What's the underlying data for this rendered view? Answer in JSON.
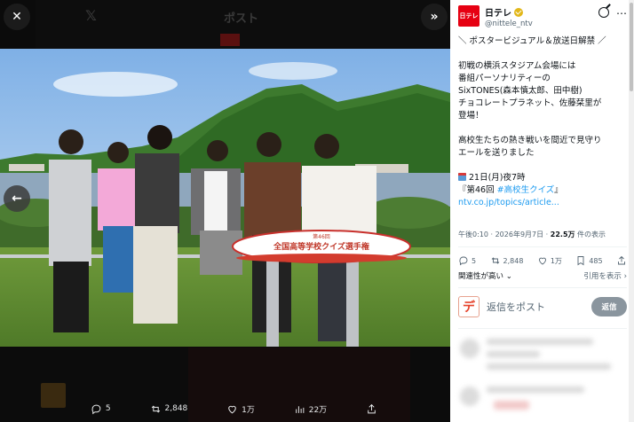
{
  "viewer": {
    "ghost_post_label": "ポスト",
    "ghost_logo_text": "日テレ",
    "sign_line1": "第46回",
    "sign_line2": "全国高等学校クイズ選手権",
    "actions": {
      "replies": "5",
      "reposts": "2,848",
      "likes": "1万",
      "views": "22万"
    }
  },
  "post": {
    "author_name": "日テレ",
    "author_handle": "@nittele_ntv",
    "logo_text": "日テレ",
    "lines": {
      "l1": "＼ ポスタービジュアル＆放送日解禁 ／",
      "l2": "初戦の横浜スタジアム会場には\n番組パーソナリティーの\nSixTONES(森本慎太郎、田中樹)\nチョコレートプラネット、佐藤栞里が\n登場！",
      "l3": "高校生たちの熱き戦いを間近で見守り\nエールを送りました",
      "date": "21日(月)夜7時",
      "hashtag_pre": "『第46回 ",
      "hashtag": "#高校生クイズ",
      "hashtag_post": "』",
      "url": "ntv.co.jp/topics/article..."
    },
    "meta_time": "午後0:10 · 2026年9月7日 · ",
    "meta_views": "22.5万",
    "meta_views_suffix": " 件の表示",
    "stats": {
      "replies": "5",
      "reposts": "2,848",
      "likes": "1万",
      "bookmarks": "485"
    },
    "sort_label": "関連性が高い ⌄",
    "quote_label": "引用を表示 ›",
    "reply_avatar_text": "デ",
    "reply_placeholder": "返信をポスト",
    "reply_button": "返信"
  }
}
